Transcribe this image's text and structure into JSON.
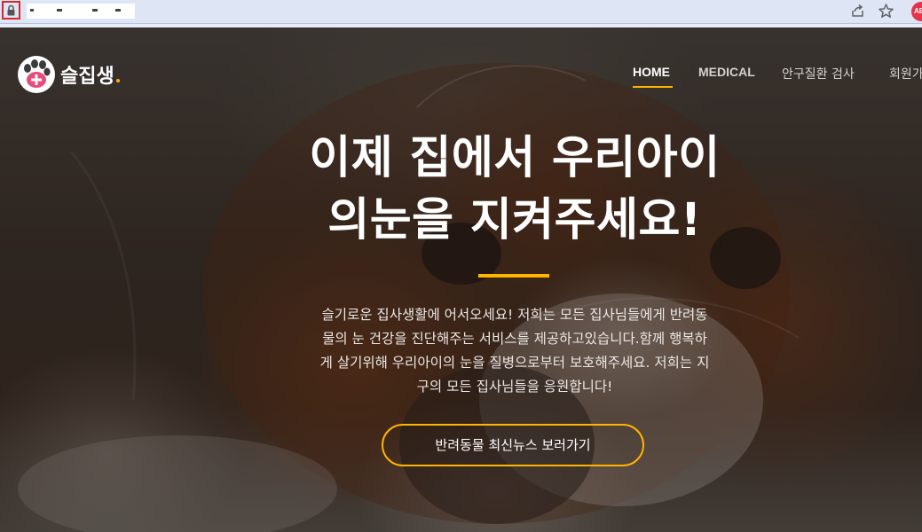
{
  "browser": {
    "lock_icon": "lock-icon",
    "share_icon": "share-icon",
    "bookmark_icon": "star-icon",
    "extension_badge": "AB"
  },
  "header": {
    "logo_icon": "paw-plus-icon",
    "logo_text": "슬집생",
    "nav": [
      {
        "label": "HOME",
        "active": true
      },
      {
        "label": "MEDICAL",
        "active": false
      },
      {
        "label": "안구질환 검사",
        "active": false
      },
      {
        "label": "회원가",
        "active": false
      }
    ]
  },
  "hero": {
    "title_lines": [
      "이제 집에서 우리아이",
      "의눈을 지켜주세요!"
    ],
    "description_lines": [
      "슬기로운 집사생활에 어서오세요! 저희는 모든 집사님들에게 반려동",
      "물의 눈 건강을 진단해주는 서비스를 제공하고있습니다.함께 행복하",
      "게 살기위해 우리아이의 눈을 질병으로부터 보호해주세요. 저희는 지",
      "구의 모든 집사님들을 응원합니다!"
    ],
    "cta_label": "반려동물 최신뉴스 보러가기"
  },
  "colors": {
    "accent": "#ffb400",
    "nav_text": "#d6d2cf",
    "overlay": "#000000"
  }
}
